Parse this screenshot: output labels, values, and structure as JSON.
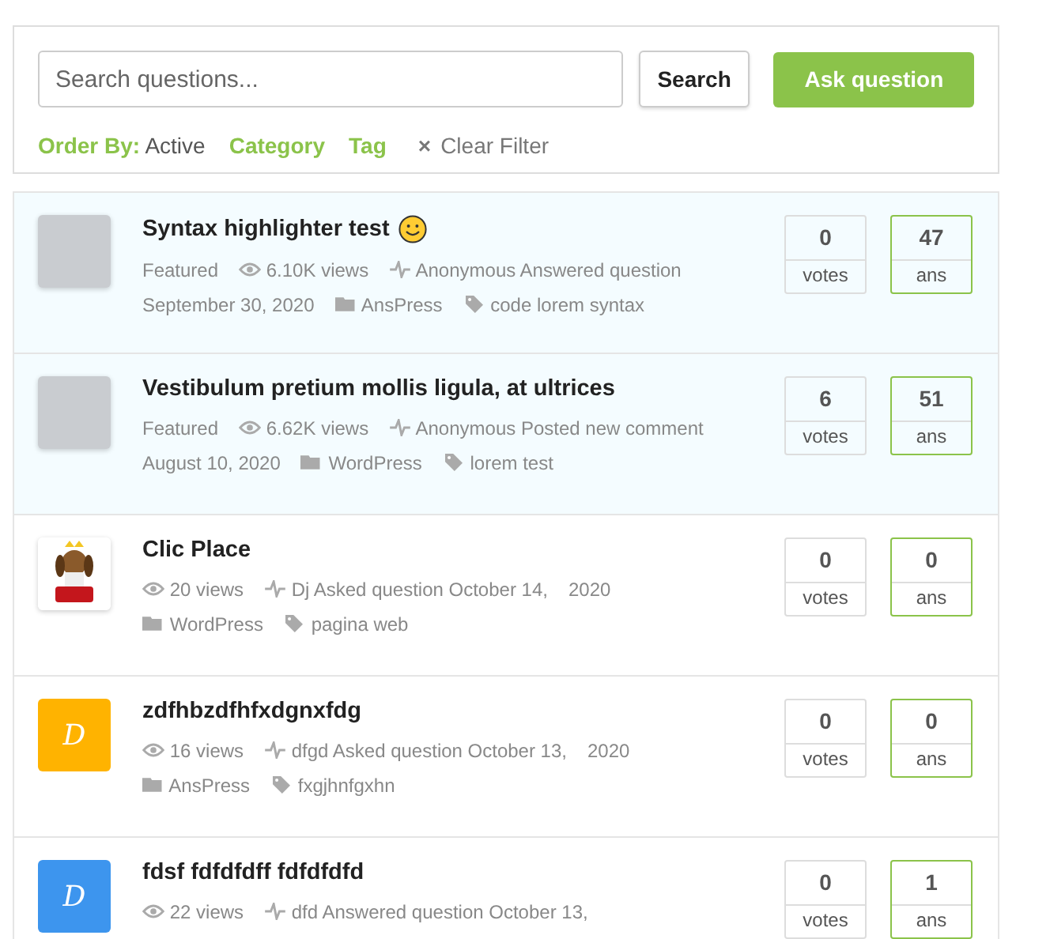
{
  "toolbar": {
    "search": {
      "placeholder": "Search questions..."
    },
    "search_button": "Search",
    "ask_button": "Ask question"
  },
  "filters": {
    "order_label": "Order By:",
    "order_value": "Active",
    "category": "Category",
    "tag": "Tag",
    "clear_icon": "×",
    "clear": "Clear Filter"
  },
  "questions": [
    {
      "title": "Syntax highlighter test",
      "smiley": true,
      "featured": true,
      "avatar": {
        "kind": "photo"
      },
      "badge": "Featured",
      "views": "6.10K views",
      "activity": "Anonymous Answered question",
      "date": "September 30, 2020",
      "category": "AnsPress",
      "tags": "code lorem syntax",
      "votes": "0",
      "votes_label": "votes",
      "answers": "47",
      "answers_label": "ans"
    },
    {
      "title": "Vestibulum pretium mollis ligula, at ultrices",
      "smiley": false,
      "featured": true,
      "avatar": {
        "kind": "photo"
      },
      "badge": "Featured",
      "views": "6.62K views",
      "activity": "Anonymous Posted new comment",
      "date": "August 10, 2020",
      "category": "WordPress",
      "tags": "lorem test",
      "votes": "6",
      "votes_label": "votes",
      "answers": "51",
      "answers_label": "ans"
    },
    {
      "title": "Clic Place",
      "smiley": false,
      "featured": false,
      "avatar": {
        "kind": "logo"
      },
      "views": "20 views",
      "activity": "Dj Asked question October 14,",
      "date": "2020",
      "category": "WordPress",
      "tags": "pagina web",
      "votes": "0",
      "votes_label": "votes",
      "answers": "0",
      "answers_label": "ans"
    },
    {
      "title": "zdfhbzdfhfxdgnxfdg",
      "smiley": false,
      "featured": false,
      "avatar": {
        "kind": "letter",
        "letter": "D",
        "color": "#ffb300"
      },
      "views": "16 views",
      "activity": "dfgd Asked question October 13,",
      "date": "2020",
      "category": "AnsPress",
      "tags": "fxgjhnfgxhn",
      "votes": "0",
      "votes_label": "votes",
      "answers": "0",
      "answers_label": "ans"
    },
    {
      "title": "fdsf fdfdfdff fdfdfdfd",
      "smiley": false,
      "featured": false,
      "avatar": {
        "kind": "letter",
        "letter": "D",
        "color": "#3d95ee"
      },
      "views": "22 views",
      "activity": "dfd Answered question October 13,",
      "votes": "0",
      "votes_label": "votes",
      "answers": "1",
      "answers_label": "ans"
    }
  ]
}
